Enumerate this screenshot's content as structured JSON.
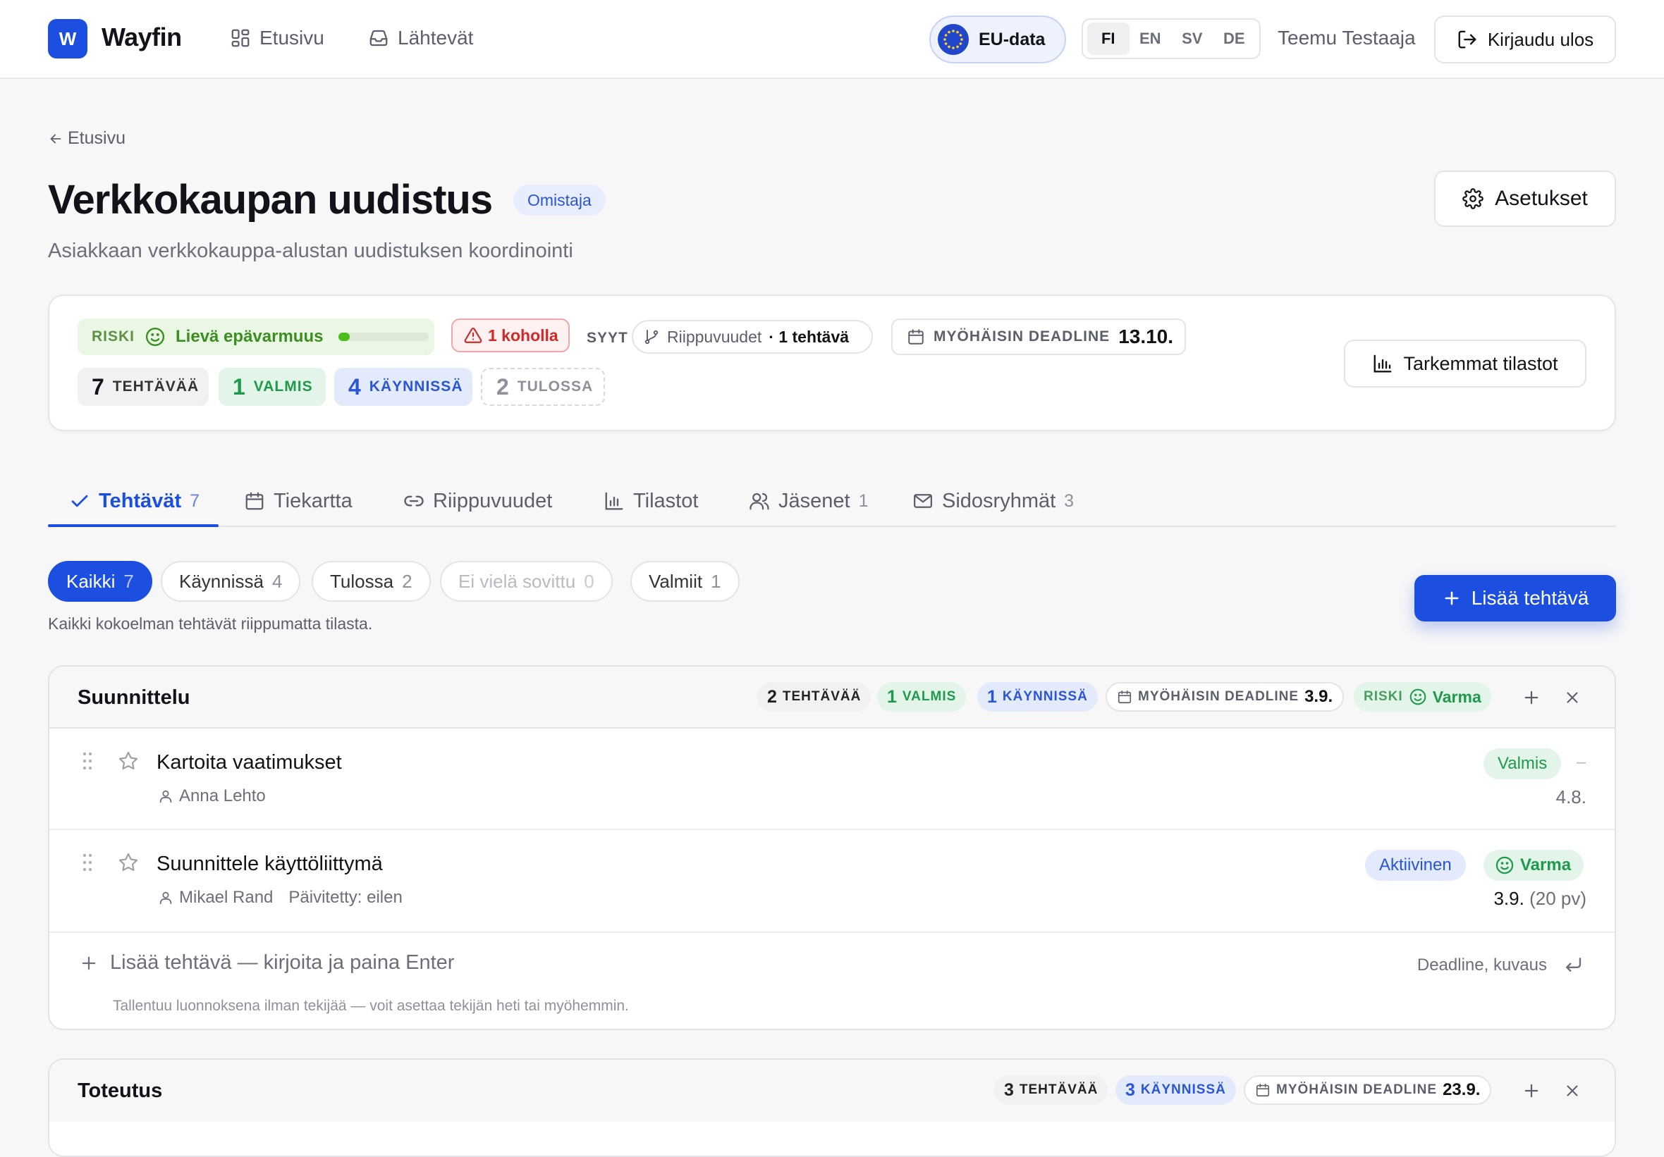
{
  "brand": {
    "logo_letter": "W",
    "name": "Wayfin",
    "accent": "#1c4fe0"
  },
  "nav": {
    "home": "Etusivu",
    "outbox": "Lähtevät"
  },
  "header_right": {
    "eu_label": "EU-data",
    "languages": [
      "FI",
      "EN",
      "SV",
      "DE"
    ],
    "active_language": "FI",
    "user_name": "Teemu Testaaja",
    "logout_label": "Kirjaudu ulos"
  },
  "page": {
    "back_label": "Etusivu",
    "title": "Verkkokaupan uudistus",
    "role_badge": "Omistaja",
    "subtitle": "Asiakkaan verkkokauppa-alustan uudistuksen koordinointi",
    "settings_label": "Asetukset"
  },
  "summary": {
    "risk_label": "RISKI",
    "risk_text": "Lievä epävarmuus",
    "risk_level": 0.12,
    "overdue_text": "1 koholla",
    "reasons_label": "SYYT",
    "dependencies_text": "Riippuvuudet",
    "dependencies_count": "· 1 tehtävä",
    "deadline_label": "MYÖHÄISIN DEADLINE",
    "deadline_value": "13.10.",
    "counts": {
      "total_num": "7",
      "total_label": "TEHTÄVÄÄ",
      "done_num": "1",
      "done_label": "VALMIS",
      "active_num": "4",
      "active_label": "KÄYNNISSÄ",
      "upcoming_num": "2",
      "upcoming_label": "TULOSSA"
    },
    "stats_button": "Tarkemmat tilastot"
  },
  "tabs": [
    {
      "label": "Tehtävät",
      "count": "7",
      "icon": "check-icon"
    },
    {
      "label": "Tiekartta",
      "count": "",
      "icon": "calendar-icon"
    },
    {
      "label": "Riippuvuudet",
      "count": "",
      "icon": "link-icon"
    },
    {
      "label": "Tilastot",
      "count": "",
      "icon": "bar-chart-icon"
    },
    {
      "label": "Jäsenet",
      "count": "1",
      "icon": "users-icon"
    },
    {
      "label": "Sidosryhmät",
      "count": "3",
      "icon": "mail-icon"
    }
  ],
  "filters": [
    {
      "label": "Kaikki",
      "count": "7"
    },
    {
      "label": "Käynnissä",
      "count": "4"
    },
    {
      "label": "Tulossa",
      "count": "2"
    },
    {
      "label": "Ei vielä sovittu",
      "count": "0"
    },
    {
      "label": "Valmiit",
      "count": "1"
    }
  ],
  "filter_hint": "Kaikki kokoelman tehtävät riippumatta tilasta.",
  "add_task_label": "Lisää tehtävä",
  "groups": [
    {
      "title": "Suunnittelu",
      "total_num": "2",
      "total_label": "TEHTÄVÄÄ",
      "done_num": "1",
      "done_label": "VALMIS",
      "active_num": "1",
      "active_label": "KÄYNNISSÄ",
      "deadline_label": "MYÖHÄISIN DEADLINE",
      "deadline_value": "3.9.",
      "risk_label": "RISKI",
      "risk_value": "Varma",
      "tasks": [
        {
          "name": "Kartoita vaatimukset",
          "assignee": "Anna Lehto",
          "updated": "",
          "status": "Valmis",
          "confidence": "–",
          "date": "4.8.",
          "days": ""
        },
        {
          "name": "Suunnittele käyttöliittymä",
          "assignee": "Mikael Rand",
          "updated": "Päivitetty: eilen",
          "status": "Aktiivinen",
          "confidence": "Varma",
          "date": "3.9.",
          "days": "(20 pv)"
        }
      ],
      "add_inline": {
        "placeholder": "Lisää tehtävä — kirjoita ja paina Enter",
        "hint": "Deadline, kuvaus",
        "note": "Tallentuu luonnoksena ilman tekijää — voit asettaa tekijän heti tai myöhemmin."
      }
    },
    {
      "title": "Toteutus",
      "total_num": "3",
      "total_label": "TEHTÄVÄÄ",
      "active_num": "3",
      "active_label": "KÄYNNISSÄ",
      "deadline_label": "MYÖHÄISIN DEADLINE",
      "deadline_value": "23.9."
    }
  ]
}
